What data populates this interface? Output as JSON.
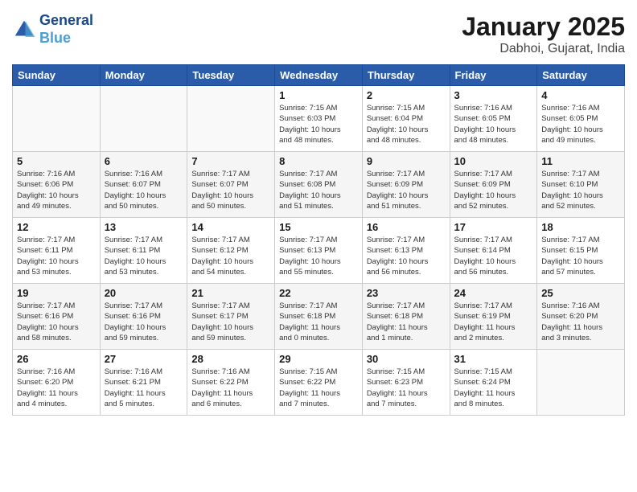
{
  "header": {
    "logo_line1": "General",
    "logo_line2": "Blue",
    "title": "January 2025",
    "subtitle": "Dabhoi, Gujarat, India"
  },
  "weekdays": [
    "Sunday",
    "Monday",
    "Tuesday",
    "Wednesday",
    "Thursday",
    "Friday",
    "Saturday"
  ],
  "weeks": [
    [
      {
        "day": "",
        "info": ""
      },
      {
        "day": "",
        "info": ""
      },
      {
        "day": "",
        "info": ""
      },
      {
        "day": "1",
        "info": "Sunrise: 7:15 AM\nSunset: 6:03 PM\nDaylight: 10 hours\nand 48 minutes."
      },
      {
        "day": "2",
        "info": "Sunrise: 7:15 AM\nSunset: 6:04 PM\nDaylight: 10 hours\nand 48 minutes."
      },
      {
        "day": "3",
        "info": "Sunrise: 7:16 AM\nSunset: 6:05 PM\nDaylight: 10 hours\nand 48 minutes."
      },
      {
        "day": "4",
        "info": "Sunrise: 7:16 AM\nSunset: 6:05 PM\nDaylight: 10 hours\nand 49 minutes."
      }
    ],
    [
      {
        "day": "5",
        "info": "Sunrise: 7:16 AM\nSunset: 6:06 PM\nDaylight: 10 hours\nand 49 minutes."
      },
      {
        "day": "6",
        "info": "Sunrise: 7:16 AM\nSunset: 6:07 PM\nDaylight: 10 hours\nand 50 minutes."
      },
      {
        "day": "7",
        "info": "Sunrise: 7:17 AM\nSunset: 6:07 PM\nDaylight: 10 hours\nand 50 minutes."
      },
      {
        "day": "8",
        "info": "Sunrise: 7:17 AM\nSunset: 6:08 PM\nDaylight: 10 hours\nand 51 minutes."
      },
      {
        "day": "9",
        "info": "Sunrise: 7:17 AM\nSunset: 6:09 PM\nDaylight: 10 hours\nand 51 minutes."
      },
      {
        "day": "10",
        "info": "Sunrise: 7:17 AM\nSunset: 6:09 PM\nDaylight: 10 hours\nand 52 minutes."
      },
      {
        "day": "11",
        "info": "Sunrise: 7:17 AM\nSunset: 6:10 PM\nDaylight: 10 hours\nand 52 minutes."
      }
    ],
    [
      {
        "day": "12",
        "info": "Sunrise: 7:17 AM\nSunset: 6:11 PM\nDaylight: 10 hours\nand 53 minutes."
      },
      {
        "day": "13",
        "info": "Sunrise: 7:17 AM\nSunset: 6:11 PM\nDaylight: 10 hours\nand 53 minutes."
      },
      {
        "day": "14",
        "info": "Sunrise: 7:17 AM\nSunset: 6:12 PM\nDaylight: 10 hours\nand 54 minutes."
      },
      {
        "day": "15",
        "info": "Sunrise: 7:17 AM\nSunset: 6:13 PM\nDaylight: 10 hours\nand 55 minutes."
      },
      {
        "day": "16",
        "info": "Sunrise: 7:17 AM\nSunset: 6:13 PM\nDaylight: 10 hours\nand 56 minutes."
      },
      {
        "day": "17",
        "info": "Sunrise: 7:17 AM\nSunset: 6:14 PM\nDaylight: 10 hours\nand 56 minutes."
      },
      {
        "day": "18",
        "info": "Sunrise: 7:17 AM\nSunset: 6:15 PM\nDaylight: 10 hours\nand 57 minutes."
      }
    ],
    [
      {
        "day": "19",
        "info": "Sunrise: 7:17 AM\nSunset: 6:16 PM\nDaylight: 10 hours\nand 58 minutes."
      },
      {
        "day": "20",
        "info": "Sunrise: 7:17 AM\nSunset: 6:16 PM\nDaylight: 10 hours\nand 59 minutes."
      },
      {
        "day": "21",
        "info": "Sunrise: 7:17 AM\nSunset: 6:17 PM\nDaylight: 10 hours\nand 59 minutes."
      },
      {
        "day": "22",
        "info": "Sunrise: 7:17 AM\nSunset: 6:18 PM\nDaylight: 11 hours\nand 0 minutes."
      },
      {
        "day": "23",
        "info": "Sunrise: 7:17 AM\nSunset: 6:18 PM\nDaylight: 11 hours\nand 1 minute."
      },
      {
        "day": "24",
        "info": "Sunrise: 7:17 AM\nSunset: 6:19 PM\nDaylight: 11 hours\nand 2 minutes."
      },
      {
        "day": "25",
        "info": "Sunrise: 7:16 AM\nSunset: 6:20 PM\nDaylight: 11 hours\nand 3 minutes."
      }
    ],
    [
      {
        "day": "26",
        "info": "Sunrise: 7:16 AM\nSunset: 6:20 PM\nDaylight: 11 hours\nand 4 minutes."
      },
      {
        "day": "27",
        "info": "Sunrise: 7:16 AM\nSunset: 6:21 PM\nDaylight: 11 hours\nand 5 minutes."
      },
      {
        "day": "28",
        "info": "Sunrise: 7:16 AM\nSunset: 6:22 PM\nDaylight: 11 hours\nand 6 minutes."
      },
      {
        "day": "29",
        "info": "Sunrise: 7:15 AM\nSunset: 6:22 PM\nDaylight: 11 hours\nand 7 minutes."
      },
      {
        "day": "30",
        "info": "Sunrise: 7:15 AM\nSunset: 6:23 PM\nDaylight: 11 hours\nand 7 minutes."
      },
      {
        "day": "31",
        "info": "Sunrise: 7:15 AM\nSunset: 6:24 PM\nDaylight: 11 hours\nand 8 minutes."
      },
      {
        "day": "",
        "info": ""
      }
    ]
  ]
}
